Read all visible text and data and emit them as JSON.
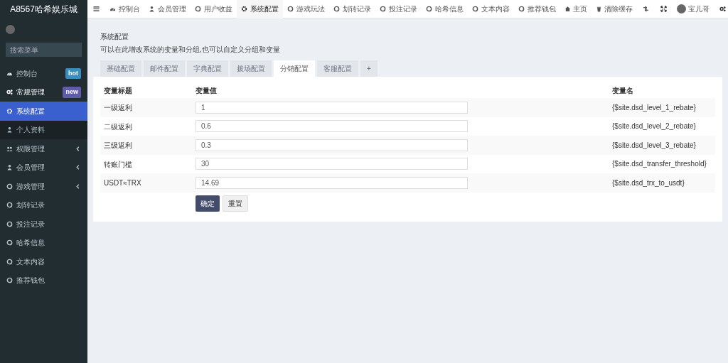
{
  "brand": "A8567哈希娱乐城",
  "sidebar": {
    "search": {
      "placeholder": "搜索菜单"
    },
    "items": [
      {
        "label": "控制台",
        "badge": {
          "text": "hot",
          "color": "#3c8dbc"
        },
        "selected": false
      },
      {
        "label": "常规管理",
        "badge": {
          "text": "new",
          "color": "#605ca8"
        },
        "selected": false,
        "expanded": true,
        "children": [
          {
            "label": "系统配置",
            "selected": true
          },
          {
            "label": "个人资料",
            "selected": false
          }
        ]
      },
      {
        "label": "权限管理",
        "selected": false,
        "expanded": false
      },
      {
        "label": "会员管理",
        "selected": false,
        "expanded": false
      },
      {
        "label": "游戏管理",
        "selected": false,
        "expanded": false
      },
      {
        "label": "划转记录",
        "selected": false
      },
      {
        "label": "投注记录",
        "selected": false
      },
      {
        "label": "哈希信息",
        "selected": false
      },
      {
        "label": "文本内容",
        "selected": false
      },
      {
        "label": "推荐钱包",
        "selected": false
      }
    ]
  },
  "top_tabs": [
    {
      "label": "控制台",
      "selected": false
    },
    {
      "label": "会员管理",
      "selected": false
    },
    {
      "label": "用户收益",
      "selected": false
    },
    {
      "label": "系统配置",
      "selected": true
    },
    {
      "label": "游戏玩法",
      "selected": false
    },
    {
      "label": "划转记录",
      "selected": false
    },
    {
      "label": "投注记录",
      "selected": false
    },
    {
      "label": "哈希信息",
      "selected": false
    },
    {
      "label": "文本内容",
      "selected": false
    },
    {
      "label": "推荐钱包",
      "selected": false
    }
  ],
  "top_right": {
    "home": "主页",
    "clear_cache": "清除缓存",
    "user": "宝儿哥"
  },
  "panel": {
    "title": "系统配置",
    "description": "可以在此增改系统的变量和分组,也可以自定义分组和变量",
    "tabs": [
      {
        "label": "基础配置",
        "selected": false
      },
      {
        "label": "邮件配置",
        "selected": false
      },
      {
        "label": "字典配置",
        "selected": false
      },
      {
        "label": "拨场配置",
        "selected": false
      },
      {
        "label": "分销配置",
        "selected": true
      },
      {
        "label": "客服配置",
        "selected": false
      },
      {
        "label": "+",
        "selected": false
      }
    ],
    "table": {
      "columns": [
        "变量标题",
        "变量值",
        "变量名"
      ],
      "rows": [
        {
          "title": "一级返利",
          "value": "1",
          "name": "{$site.dsd_level_1_rebate}"
        },
        {
          "title": "二级返利",
          "value": "0.6",
          "name": "{$site.dsd_level_2_rebate}"
        },
        {
          "title": "三级返利",
          "value": "0.3",
          "name": "{$site.dsd_level_3_rebate}"
        },
        {
          "title": "转账门槛",
          "value": "30",
          "name": "{$site.dsd_transfer_threshold}"
        },
        {
          "title": "USDT≈TRX",
          "value": "14.69",
          "name": "{$site.dsd_trx_to_usdt}"
        }
      ]
    },
    "buttons": {
      "submit": "确定",
      "reset": "重置"
    }
  }
}
